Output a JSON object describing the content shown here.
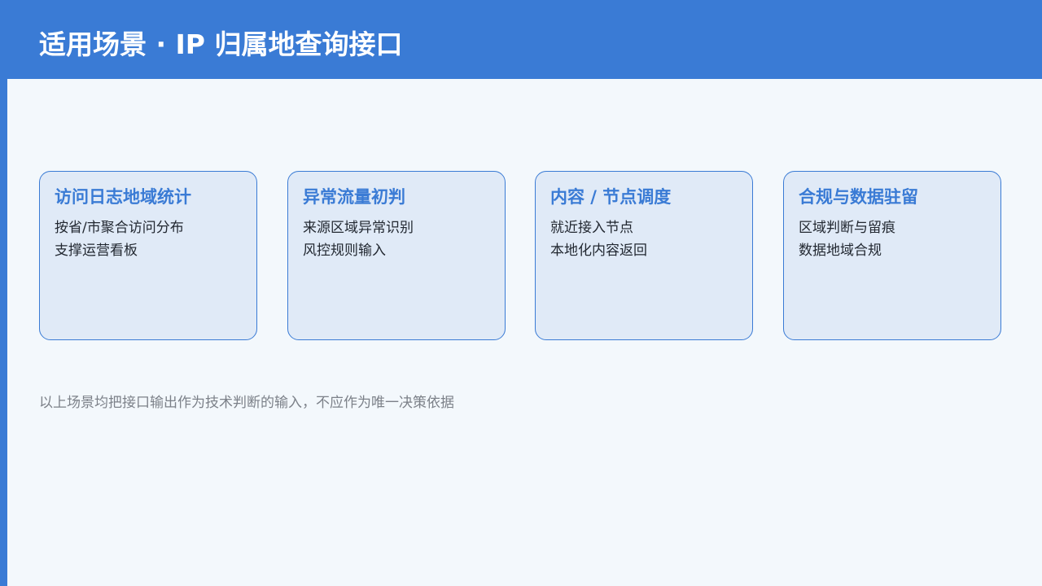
{
  "header": {
    "title": "适用场景 · IP 归属地查询接口"
  },
  "cards": [
    {
      "title": "访问日志地域统计",
      "lines": [
        "按省/市聚合访问分布",
        "支撑运营看板"
      ]
    },
    {
      "title": "异常流量初判",
      "lines": [
        "来源区域异常识别",
        "风控规则输入"
      ]
    },
    {
      "title": "内容 / 节点调度",
      "lines": [
        "就近接入节点",
        "本地化内容返回"
      ]
    },
    {
      "title": "合规与数据驻留",
      "lines": [
        "区域判断与留痕",
        "数据地域合规"
      ]
    }
  ],
  "footnote": "以上场景均把接口输出作为技术判断的输入，不应作为唯一决策依据",
  "colors": {
    "accent": "#3a7bd5",
    "background": "#f3f8fc",
    "card_fill": "#e0eaf7",
    "body_text": "#222831",
    "muted_text": "#7c8189"
  }
}
